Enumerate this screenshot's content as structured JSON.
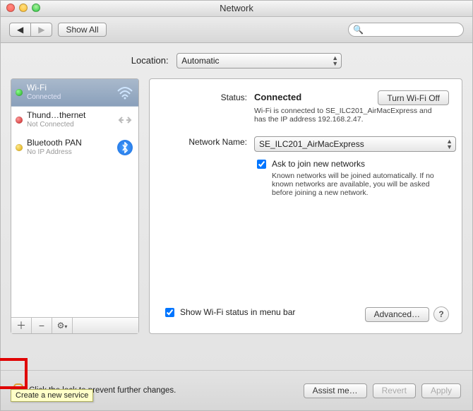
{
  "window": {
    "title": "Network"
  },
  "toolbar": {
    "back": "◀",
    "forward": "▶",
    "show_all": "Show All",
    "search_placeholder": ""
  },
  "location": {
    "label": "Location:",
    "value": "Automatic"
  },
  "sidebar": {
    "items": [
      {
        "name": "Wi-Fi",
        "status": "Connected",
        "dot": "green",
        "icon": "wifi",
        "selected": true
      },
      {
        "name": "Thund…thernet",
        "status": "Not Connected",
        "dot": "red",
        "icon": "thunderbolt",
        "selected": false
      },
      {
        "name": "Bluetooth PAN",
        "status": "No IP Address",
        "dot": "yellow",
        "icon": "bluetooth",
        "selected": false
      }
    ],
    "add_tooltip": "Create a new service"
  },
  "details": {
    "status_label": "Status:",
    "status_value": "Connected",
    "turn_off": "Turn Wi-Fi Off",
    "status_desc": "Wi-Fi is connected to SE_ILC201_AirMacExpress and has the IP address 192.168.2.47.",
    "network_label": "Network Name:",
    "network_value": "SE_ILC201_AirMacExpress",
    "ask_join": "Ask to join new networks",
    "ask_join_desc": "Known networks will be joined automatically. If no known networks are available, you will be asked before joining a new network.",
    "menu_bar": "Show Wi-Fi status in menu bar",
    "advanced": "Advanced…"
  },
  "footer": {
    "lock_text": "Click the lock to prevent further changes.",
    "assist": "Assist me…",
    "revert": "Revert",
    "apply": "Apply"
  }
}
